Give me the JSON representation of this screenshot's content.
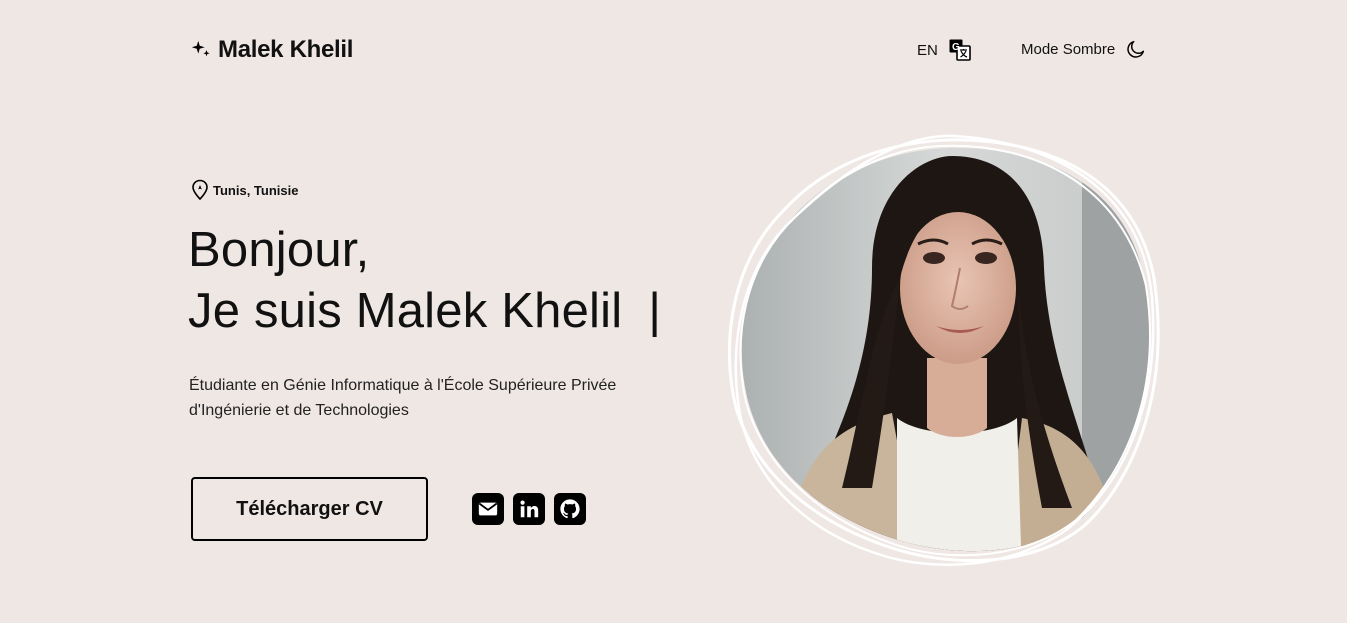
{
  "header": {
    "logo_text": "Malek Khelil",
    "logo_icon": "sparkle-icon",
    "language_label": "EN",
    "language_icon": "translate-icon",
    "theme_label": "Mode Sombre",
    "theme_icon": "moon-icon"
  },
  "hero": {
    "location": "Tunis, Tunisie",
    "location_icon": "map-pin-icon",
    "greeting_line1": "Bonjour,",
    "greeting_line2": "Je suis Malek Khelil",
    "cursor": "|",
    "description": "Étudiante en Génie Informatique à l'École Supérieure Privée d'Ingénierie et de Technologies",
    "cv_button_label": "Télécharger CV",
    "socials": [
      "mail-icon",
      "linkedin-icon",
      "github-icon"
    ]
  },
  "colors": {
    "background": "#efe7e4",
    "text": "#111111",
    "accent": "#000000"
  }
}
